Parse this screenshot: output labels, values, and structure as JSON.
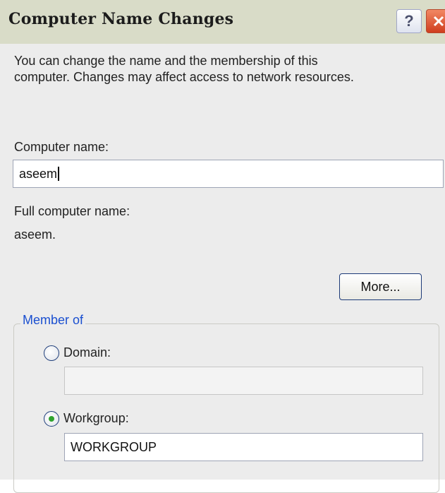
{
  "dialog": {
    "title": "Computer Name Changes",
    "help_symbol": "?",
    "description_line1": "You can change the name and the membership of this",
    "description_line2": "computer. Changes may affect access to network resources.",
    "computer_name_label": "Computer name:",
    "computer_name_value": "aseem",
    "full_name_label": "Full computer name:",
    "full_name_value": "aseem.",
    "more_button": "More...",
    "member_of": {
      "legend": "Member of",
      "domain_label": "Domain:",
      "domain_selected": false,
      "domain_value": "",
      "workgroup_label": "Workgroup:",
      "workgroup_selected": true,
      "workgroup_value": "WORKGROUP"
    }
  },
  "icons": {
    "help": "question-mark-icon",
    "close": "close-x-icon"
  },
  "colors": {
    "title_bar": "#d9dcc8",
    "dialog_background": "#ececec",
    "close_button": "#d8492a",
    "group_legend": "#1a4fd0",
    "radio_selected_dot": "#2fa32f"
  }
}
